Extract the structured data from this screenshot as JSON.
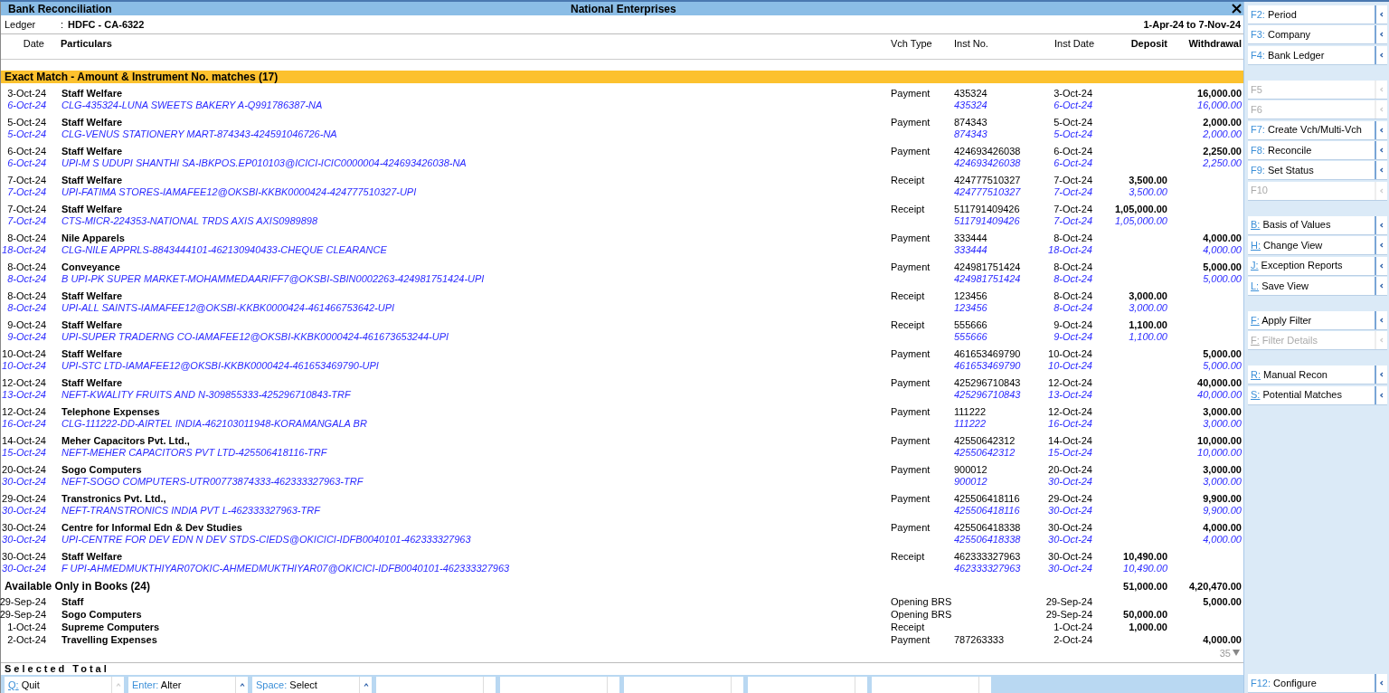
{
  "window": {
    "title": "Bank Reconciliation",
    "company": "National Enterprises"
  },
  "ledger": {
    "label": "Ledger",
    "separator": ":",
    "value": "HDFC - CA-6322",
    "period": "1-Apr-24 to 7-Nov-24"
  },
  "columns": {
    "date": "Date",
    "particulars": "Particulars",
    "vch_type": "Vch Type",
    "inst_no": "Inst No.",
    "inst_date": "Inst Date",
    "deposit": "Deposit",
    "withdrawal": "Withdrawal"
  },
  "exact_match": {
    "title": "Exact Match - Amount & Instrument No. matches (17)",
    "rows": [
      {
        "date": "3-Oct-24",
        "particulars": "Staff Welfare",
        "vch_type": "Payment",
        "inst_no": "435324",
        "inst_date": "3-Oct-24",
        "withdrawal": "16,000.00",
        "bank": {
          "date": "6-Oct-24",
          "particulars": "CLG-435324-LUNA SWEETS BAKERY A-Q991786387-NA",
          "inst_no": "435324",
          "inst_date": "6-Oct-24",
          "withdrawal": "16,000.00"
        }
      },
      {
        "date": "5-Oct-24",
        "particulars": "Staff Welfare",
        "vch_type": "Payment",
        "inst_no": "874343",
        "inst_date": "5-Oct-24",
        "withdrawal": "2,000.00",
        "bank": {
          "date": "5-Oct-24",
          "particulars": "CLG-VENUS STATIONERY MART-874343-424591046726-NA",
          "inst_no": "874343",
          "inst_date": "5-Oct-24",
          "withdrawal": "2,000.00"
        }
      },
      {
        "date": "6-Oct-24",
        "particulars": "Staff Welfare",
        "vch_type": "Payment",
        "inst_no": "424693426038",
        "inst_date": "6-Oct-24",
        "withdrawal": "2,250.00",
        "bank": {
          "date": "6-Oct-24",
          "particulars": "UPI-M S UDUPI SHANTHI SA-IBKPOS.EP010103@ICICI-ICIC0000004-424693426038-NA",
          "inst_no": "424693426038",
          "inst_date": "6-Oct-24",
          "withdrawal": "2,250.00"
        }
      },
      {
        "date": "7-Oct-24",
        "particulars": "Staff Welfare",
        "vch_type": "Receipt",
        "inst_no": "424777510327",
        "inst_date": "7-Oct-24",
        "deposit": "3,500.00",
        "bank": {
          "date": "7-Oct-24",
          "particulars": "UPI-FATIMA STORES-IAMAFEE12@OKSBI-KKBK0000424-424777510327-UPI",
          "inst_no": "424777510327",
          "inst_date": "7-Oct-24",
          "deposit": "3,500.00"
        }
      },
      {
        "date": "7-Oct-24",
        "particulars": "Staff Welfare",
        "vch_type": "Receipt",
        "inst_no": "511791409426",
        "inst_date": "7-Oct-24",
        "deposit": "1,05,000.00",
        "bank": {
          "date": "7-Oct-24",
          "particulars": "CTS-MICR-224353-NATIONAL TRDS AXIS AXIS0989898",
          "inst_no": "511791409426",
          "inst_date": "7-Oct-24",
          "deposit": "1,05,000.00"
        }
      },
      {
        "date": "8-Oct-24",
        "particulars": "Nile Apparels",
        "vch_type": "Payment",
        "inst_no": "333444",
        "inst_date": "8-Oct-24",
        "withdrawal": "4,000.00",
        "bank": {
          "date": "18-Oct-24",
          "particulars": "CLG-NILE APPRLS-8843444101-462130940433-CHEQUE CLEARANCE",
          "inst_no": "333444",
          "inst_date": "18-Oct-24",
          "withdrawal": "4,000.00"
        }
      },
      {
        "date": "8-Oct-24",
        "particulars": "Conveyance",
        "vch_type": "Payment",
        "inst_no": "424981751424",
        "inst_date": "8-Oct-24",
        "withdrawal": "5,000.00",
        "bank": {
          "date": "8-Oct-24",
          "particulars": "B UPI-PK SUPER MARKET-MOHAMMEDAARIFF7@OKSBI-SBIN0002263-424981751424-UPI",
          "inst_no": "424981751424",
          "inst_date": "8-Oct-24",
          "withdrawal": "5,000.00"
        }
      },
      {
        "date": "8-Oct-24",
        "particulars": "Staff Welfare",
        "vch_type": "Receipt",
        "inst_no": "123456",
        "inst_date": "8-Oct-24",
        "deposit": "3,000.00",
        "bank": {
          "date": "8-Oct-24",
          "particulars": "UPI-ALL SAINTS-IAMAFEE12@OKSBI-KKBK0000424-461466753642-UPI",
          "inst_no": "123456",
          "inst_date": "8-Oct-24",
          "deposit": "3,000.00"
        }
      },
      {
        "date": "9-Oct-24",
        "particulars": "Staff Welfare",
        "vch_type": "Receipt",
        "inst_no": "555666",
        "inst_date": "9-Oct-24",
        "deposit": "1,100.00",
        "bank": {
          "date": "9-Oct-24",
          "particulars": "UPI-SUPER TRADERNG CO-IAMAFEE12@OKSBI-KKBK0000424-461673653244-UPI",
          "inst_no": "555666",
          "inst_date": "9-Oct-24",
          "deposit": "1,100.00"
        }
      },
      {
        "date": "10-Oct-24",
        "particulars": "Staff Welfare",
        "vch_type": "Payment",
        "inst_no": "461653469790",
        "inst_date": "10-Oct-24",
        "withdrawal": "5,000.00",
        "bank": {
          "date": "10-Oct-24",
          "particulars": "UPI-STC LTD-IAMAFEE12@OKSBI-KKBK0000424-461653469790-UPI",
          "inst_no": "461653469790",
          "inst_date": "10-Oct-24",
          "withdrawal": "5,000.00"
        }
      },
      {
        "date": "12-Oct-24",
        "particulars": "Staff Welfare",
        "vch_type": "Payment",
        "inst_no": "425296710843",
        "inst_date": "12-Oct-24",
        "withdrawal": "40,000.00",
        "bank": {
          "date": "13-Oct-24",
          "particulars": "NEFT-KWALITY FRUITS AND N-309855333-425296710843-TRF",
          "inst_no": "425296710843",
          "inst_date": "13-Oct-24",
          "withdrawal": "40,000.00"
        }
      },
      {
        "date": "12-Oct-24",
        "particulars": "Telephone Expenses",
        "vch_type": "Payment",
        "inst_no": "111222",
        "inst_date": "12-Oct-24",
        "withdrawal": "3,000.00",
        "bank": {
          "date": "16-Oct-24",
          "particulars": "CLG-111222-DD-AIRTEL INDIA-462103011948-KORAMANGALA BR",
          "inst_no": "111222",
          "inst_date": "16-Oct-24",
          "withdrawal": "3,000.00"
        }
      },
      {
        "date": "14-Oct-24",
        "particulars": "Meher Capacitors Pvt. Ltd.,",
        "vch_type": "Payment",
        "inst_no": "42550642312",
        "inst_date": "14-Oct-24",
        "withdrawal": "10,000.00",
        "bank": {
          "date": "15-Oct-24",
          "particulars": "NEFT-MEHER CAPACITORS PVT LTD-425506418116-TRF",
          "inst_no": "42550642312",
          "inst_date": "15-Oct-24",
          "withdrawal": "10,000.00"
        }
      },
      {
        "date": "20-Oct-24",
        "particulars": "Sogo Computers",
        "vch_type": "Payment",
        "inst_no": "900012",
        "inst_date": "20-Oct-24",
        "withdrawal": "3,000.00",
        "bank": {
          "date": "30-Oct-24",
          "particulars": "NEFT-SOGO COMPUTERS-UTR00773874333-462333327963-TRF",
          "inst_no": "900012",
          "inst_date": "30-Oct-24",
          "withdrawal": "3,000.00"
        }
      },
      {
        "date": "29-Oct-24",
        "particulars": "Transtronics Pvt. Ltd.,",
        "vch_type": "Payment",
        "inst_no": "425506418116",
        "inst_date": "29-Oct-24",
        "withdrawal": "9,900.00",
        "bank": {
          "date": "30-Oct-24",
          "particulars": "NEFT-TRANSTRONICS INDIA PVT L-462333327963-TRF",
          "inst_no": "425506418116",
          "inst_date": "30-Oct-24",
          "withdrawal": "9,900.00"
        }
      },
      {
        "date": "30-Oct-24",
        "particulars": "Centre for Informal Edn & Dev Studies",
        "vch_type": "Payment",
        "inst_no": "425506418338",
        "inst_date": "30-Oct-24",
        "withdrawal": "4,000.00",
        "bank": {
          "date": "30-Oct-24",
          "particulars": "UPI-CENTRE FOR DEV EDN N DEV STDS-CIEDS@OKICICI-IDFB0040101-462333327963",
          "inst_no": "425506418338",
          "inst_date": "30-Oct-24",
          "withdrawal": "4,000.00"
        }
      },
      {
        "date": "30-Oct-24",
        "particulars": "Staff Welfare",
        "vch_type": "Receipt",
        "inst_no": "462333327963",
        "inst_date": "30-Oct-24",
        "deposit": "10,490.00",
        "bank": {
          "date": "30-Oct-24",
          "particulars": "F UPI-AHMEDMUKTHIYAR07OKIC-AHMEDMUKTHIYAR07@OKICICI-IDFB0040101-462333327963",
          "inst_no": "462333327963",
          "inst_date": "30-Oct-24",
          "deposit": "10,490.00"
        }
      }
    ]
  },
  "books_only": {
    "title": "Available Only in Books (24)",
    "total_deposit": "51,000.00",
    "total_withdrawal": "4,20,470.00",
    "rows": [
      {
        "date": "29-Sep-24",
        "particulars": "Staff",
        "vch_type": "Opening BRS",
        "inst_date": "29-Sep-24",
        "withdrawal": "5,000.00"
      },
      {
        "date": "29-Sep-24",
        "particulars": "Sogo Computers",
        "vch_type": "Opening BRS",
        "inst_date": "29-Sep-24",
        "deposit": "50,000.00"
      },
      {
        "date": "1-Oct-24",
        "particulars": "Supreme Computers",
        "vch_type": "Receipt",
        "inst_date": "1-Oct-24",
        "deposit": "1,000.00"
      },
      {
        "date": "2-Oct-24",
        "particulars": "Travelling Expenses",
        "vch_type": "Payment",
        "inst_no": "787263333",
        "inst_date": "2-Oct-24",
        "withdrawal": "4,000.00"
      }
    ]
  },
  "more_count": "35",
  "selected_total": {
    "label": "Selected Total"
  },
  "footer_buttons": [
    {
      "key": "Q:",
      "label": "Quit",
      "kind": "letter"
    },
    {
      "key": "Enter:",
      "label": "Alter",
      "kind": "function"
    },
    {
      "key": "Space:",
      "label": "Select",
      "kind": "function"
    },
    {
      "kind": "empty"
    },
    {
      "kind": "empty"
    },
    {
      "kind": "empty"
    },
    {
      "kind": "empty"
    },
    {
      "kind": "empty"
    }
  ],
  "side_groups": [
    [
      {
        "key": "F2:",
        "label": "Period",
        "kind": "function",
        "disabled": false
      },
      {
        "key": "F3:",
        "label": "Company",
        "kind": "function",
        "disabled": false
      },
      {
        "key": "F4:",
        "label": "Bank Ledger",
        "kind": "function",
        "disabled": false
      }
    ],
    [
      {
        "key": "F5",
        "kind": "function",
        "disabled": true
      },
      {
        "key": "F6",
        "kind": "function",
        "disabled": true
      },
      {
        "key": "F7:",
        "label": "Create Vch/Multi-Vch",
        "kind": "function",
        "disabled": false
      },
      {
        "key": "F8:",
        "label": "Reconcile",
        "kind": "function",
        "disabled": false
      },
      {
        "key": "F9:",
        "label": "Set Status",
        "kind": "function",
        "disabled": false
      },
      {
        "key": "F10",
        "kind": "function",
        "disabled": true
      }
    ],
    [
      {
        "key": "B:",
        "label": "Basis of Values",
        "kind": "letter",
        "disabled": false
      },
      {
        "key": "H:",
        "label": "Change View",
        "kind": "letter",
        "disabled": false
      },
      {
        "key": "J:",
        "label": "Exception Reports",
        "kind": "letter",
        "disabled": false
      },
      {
        "key": "L:",
        "label": "Save View",
        "kind": "letter",
        "disabled": false
      }
    ],
    [
      {
        "key": "F:",
        "label": "Apply Filter",
        "kind": "letter",
        "disabled": false
      },
      {
        "key": "F:",
        "label": "Filter Details",
        "kind": "letter",
        "disabled": true
      }
    ],
    [
      {
        "key": "R:",
        "label": "Manual Recon",
        "kind": "letter",
        "disabled": false
      },
      {
        "key": "S:",
        "label": "Potential Matches",
        "kind": "letter",
        "disabled": false
      }
    ]
  ],
  "side_footer": {
    "key": "F12:",
    "label": "Configure",
    "kind": "function"
  }
}
